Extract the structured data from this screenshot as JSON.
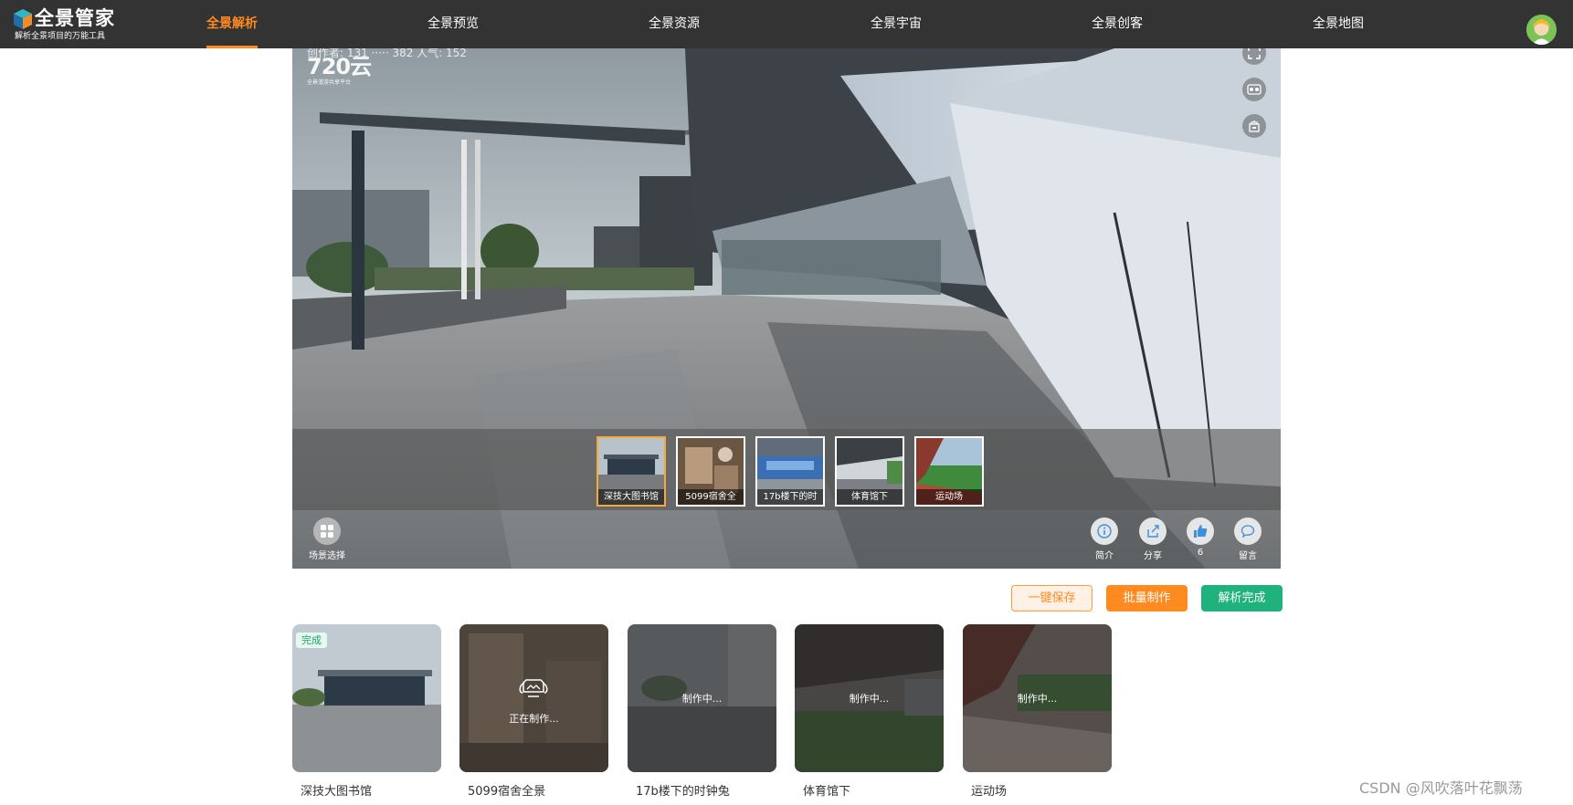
{
  "header": {
    "logo_title": "全景管家",
    "logo_subtitle": "解析全景项目的万能工具",
    "nav": [
      {
        "label": "全景解析",
        "active": true
      },
      {
        "label": "全景预览",
        "active": false
      },
      {
        "label": "全景资源",
        "active": false
      },
      {
        "label": "全景宇宙",
        "active": false
      },
      {
        "label": "全景创客",
        "active": false
      },
      {
        "label": "全景地图",
        "active": false
      }
    ],
    "avatar_icon": "user-avatar-icon"
  },
  "viewer": {
    "counter_text": "创作者: 131 ····· 382    人气: 152",
    "watermark_brand": "720云",
    "watermark_tag": "全景漫游共享平台",
    "side_tools": [
      "fullscreen-icon",
      "vr-glasses-icon",
      "gyroscope-icon"
    ],
    "thumbnails": [
      {
        "caption": "深技大图书馆",
        "selected": true
      },
      {
        "caption": "5099宿舍全",
        "selected": false
      },
      {
        "caption": "17b楼下的时",
        "selected": false
      },
      {
        "caption": "体育馆下",
        "selected": false
      },
      {
        "caption": "运动场",
        "selected": false
      }
    ],
    "scene_select_label": "场景选择",
    "actions": [
      {
        "label": "简介",
        "icon": "info-icon"
      },
      {
        "label": "分享",
        "icon": "share-icon"
      },
      {
        "label": "6",
        "icon": "thumbs-up-icon"
      },
      {
        "label": "留言",
        "icon": "comment-icon"
      }
    ]
  },
  "buttons": {
    "save": "一键保存",
    "batch": "批量制作",
    "done": "解析完成"
  },
  "cards": [
    {
      "name": "深技大图书馆",
      "tag": "完成",
      "status": ""
    },
    {
      "name": "5099宿舍全景",
      "tag": "",
      "status": "正在制作..."
    },
    {
      "name": "17b楼下的时钟兔",
      "tag": "",
      "status": "制作中..."
    },
    {
      "name": "体育馆下",
      "tag": "",
      "status": "制作中..."
    },
    {
      "name": "运动场",
      "tag": "",
      "status": "制作中..."
    }
  ],
  "watermark": "CSDN @风吹落叶花飘荡",
  "colors": {
    "topbar": "#333333",
    "accent_orange": "#ff8a1f",
    "accent_green": "#1fb27c",
    "selected_thumb_border": "#f5a93a"
  }
}
